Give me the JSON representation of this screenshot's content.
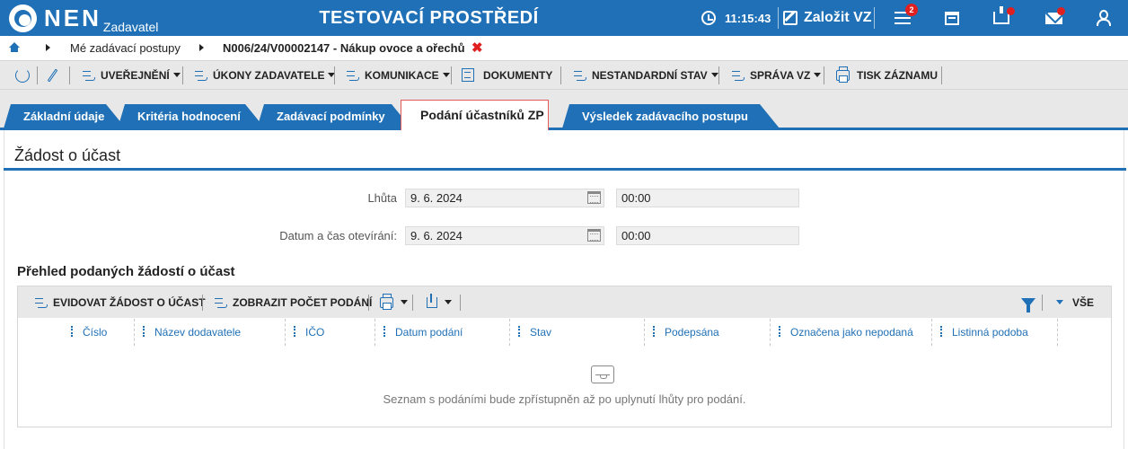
{
  "header": {
    "logo_text": "NEN",
    "logo_sub": "Zadavatel",
    "environment_title": "TESTOVACÍ PROSTŘEDÍ",
    "clock_time": "11:15:43",
    "create_label": "Založit VZ",
    "notification_count": "2",
    "icons": [
      "clock-icon",
      "create-icon",
      "menu-icon",
      "calendar-icon",
      "inbox-icon",
      "mail-icon",
      "user-icon"
    ],
    "accent_color": "#1f70b6",
    "alert_color": "#e02020"
  },
  "breadcrumb": {
    "item1": "Mé zadávací postupy",
    "item2": "N006/24/V00002147 - Nákup ovoce a ořechů",
    "close_icon": "✖"
  },
  "toolbar": {
    "items": [
      {
        "label": "UVEŘEJNĚNÍ"
      },
      {
        "label": "ÚKONY ZADAVATELE"
      },
      {
        "label": "KOMUNIKACE"
      },
      {
        "label": "DOKUMENTY"
      },
      {
        "label": "NESTANDARDNÍ STAV"
      },
      {
        "label": "SPRÁVA VZ"
      },
      {
        "label": "TISK ZÁZNAMU"
      }
    ]
  },
  "tabs": [
    {
      "label": "Základní údaje"
    },
    {
      "label": "Kritéria hodnocení"
    },
    {
      "label": "Zadávací podmínky"
    },
    {
      "label": "Podání účastníků ZP"
    },
    {
      "label": "Výsledek zadávacího postupu"
    }
  ],
  "section": {
    "title": "Žádost o účast",
    "deadline_label": "Lhůta",
    "deadline_date": "9. 6. 2024",
    "deadline_time": "00:00",
    "opening_label": "Datum a čas otevírání:",
    "opening_date": "9. 6. 2024",
    "opening_time": "00:00"
  },
  "overview": {
    "title": "Přehled podaných žádostí o účast",
    "toolbar": {
      "register_label": "EVIDOVAT ŽÁDOST O ÚČAST",
      "count_label": "ZOBRAZIT POČET PODÁNÍ",
      "all_label": "VŠE"
    },
    "columns": [
      "Číslo",
      "Název dodavatele",
      "IČO",
      "Datum podání",
      "Stav",
      "Podepsána",
      "Označena jako nepodaná",
      "Listinná podoba"
    ],
    "empty_message": "Seznam s podáními bude zpřístupněn až po uplynutí lhůty pro podání."
  }
}
